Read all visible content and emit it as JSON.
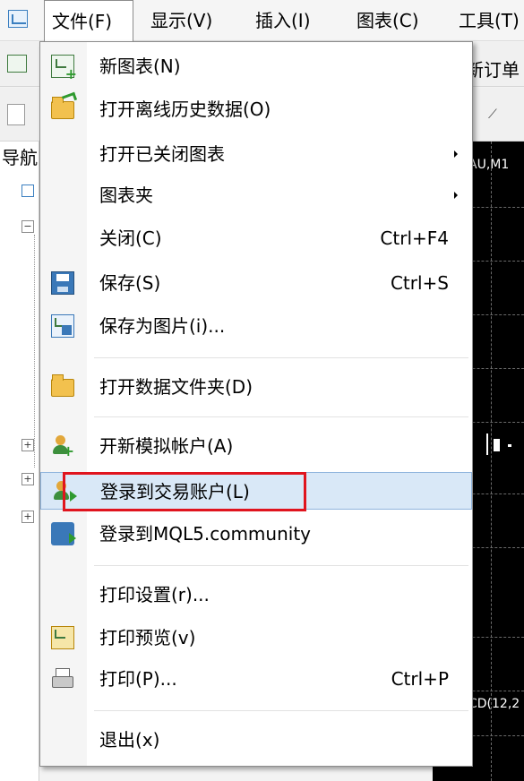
{
  "menubar": {
    "items": [
      {
        "label": "文件(F)"
      },
      {
        "label": "显示(V)"
      },
      {
        "label": "插入(I)"
      },
      {
        "label": "图表(C)"
      },
      {
        "label": "工具(T)"
      }
    ]
  },
  "background": {
    "navigator_title": "导航",
    "toolbar_text": "新订单",
    "chart_label_top": "AU,M1",
    "chart_label_bottom": "CD(12,2"
  },
  "file_menu": {
    "items": [
      {
        "label": "新图表(N)",
        "icon": "new-chart-icon"
      },
      {
        "label": "打开离线历史数据(O)",
        "icon": "open-folder-icon"
      },
      {
        "label": "打开已关闭图表",
        "submenu": true
      },
      {
        "label": "图表夹",
        "submenu": true
      },
      {
        "label": "关闭(C)",
        "shortcut": "Ctrl+F4"
      },
      {
        "label": "保存(S)",
        "shortcut": "Ctrl+S",
        "icon": "save-icon"
      },
      {
        "label": "保存为图片(i)...",
        "icon": "save-image-icon"
      },
      {
        "label": "打开数据文件夹(D)",
        "icon": "folder-icon"
      },
      {
        "label": "开新模拟帐户(A)",
        "icon": "new-account-icon"
      },
      {
        "label": "登录到交易账户(L)",
        "icon": "login-account-icon",
        "selected": true
      },
      {
        "label": "登录到MQL5.community",
        "icon": "mql5-login-icon"
      },
      {
        "label": "打印设置(r)..."
      },
      {
        "label": "打印预览(v)",
        "icon": "print-preview-icon"
      },
      {
        "label": "打印(P)...",
        "shortcut": "Ctrl+P",
        "icon": "printer-icon"
      },
      {
        "label": "退出(x)"
      }
    ]
  },
  "colors": {
    "highlight_box": "#e0141e",
    "selection_bg": "#d9e8f7"
  }
}
